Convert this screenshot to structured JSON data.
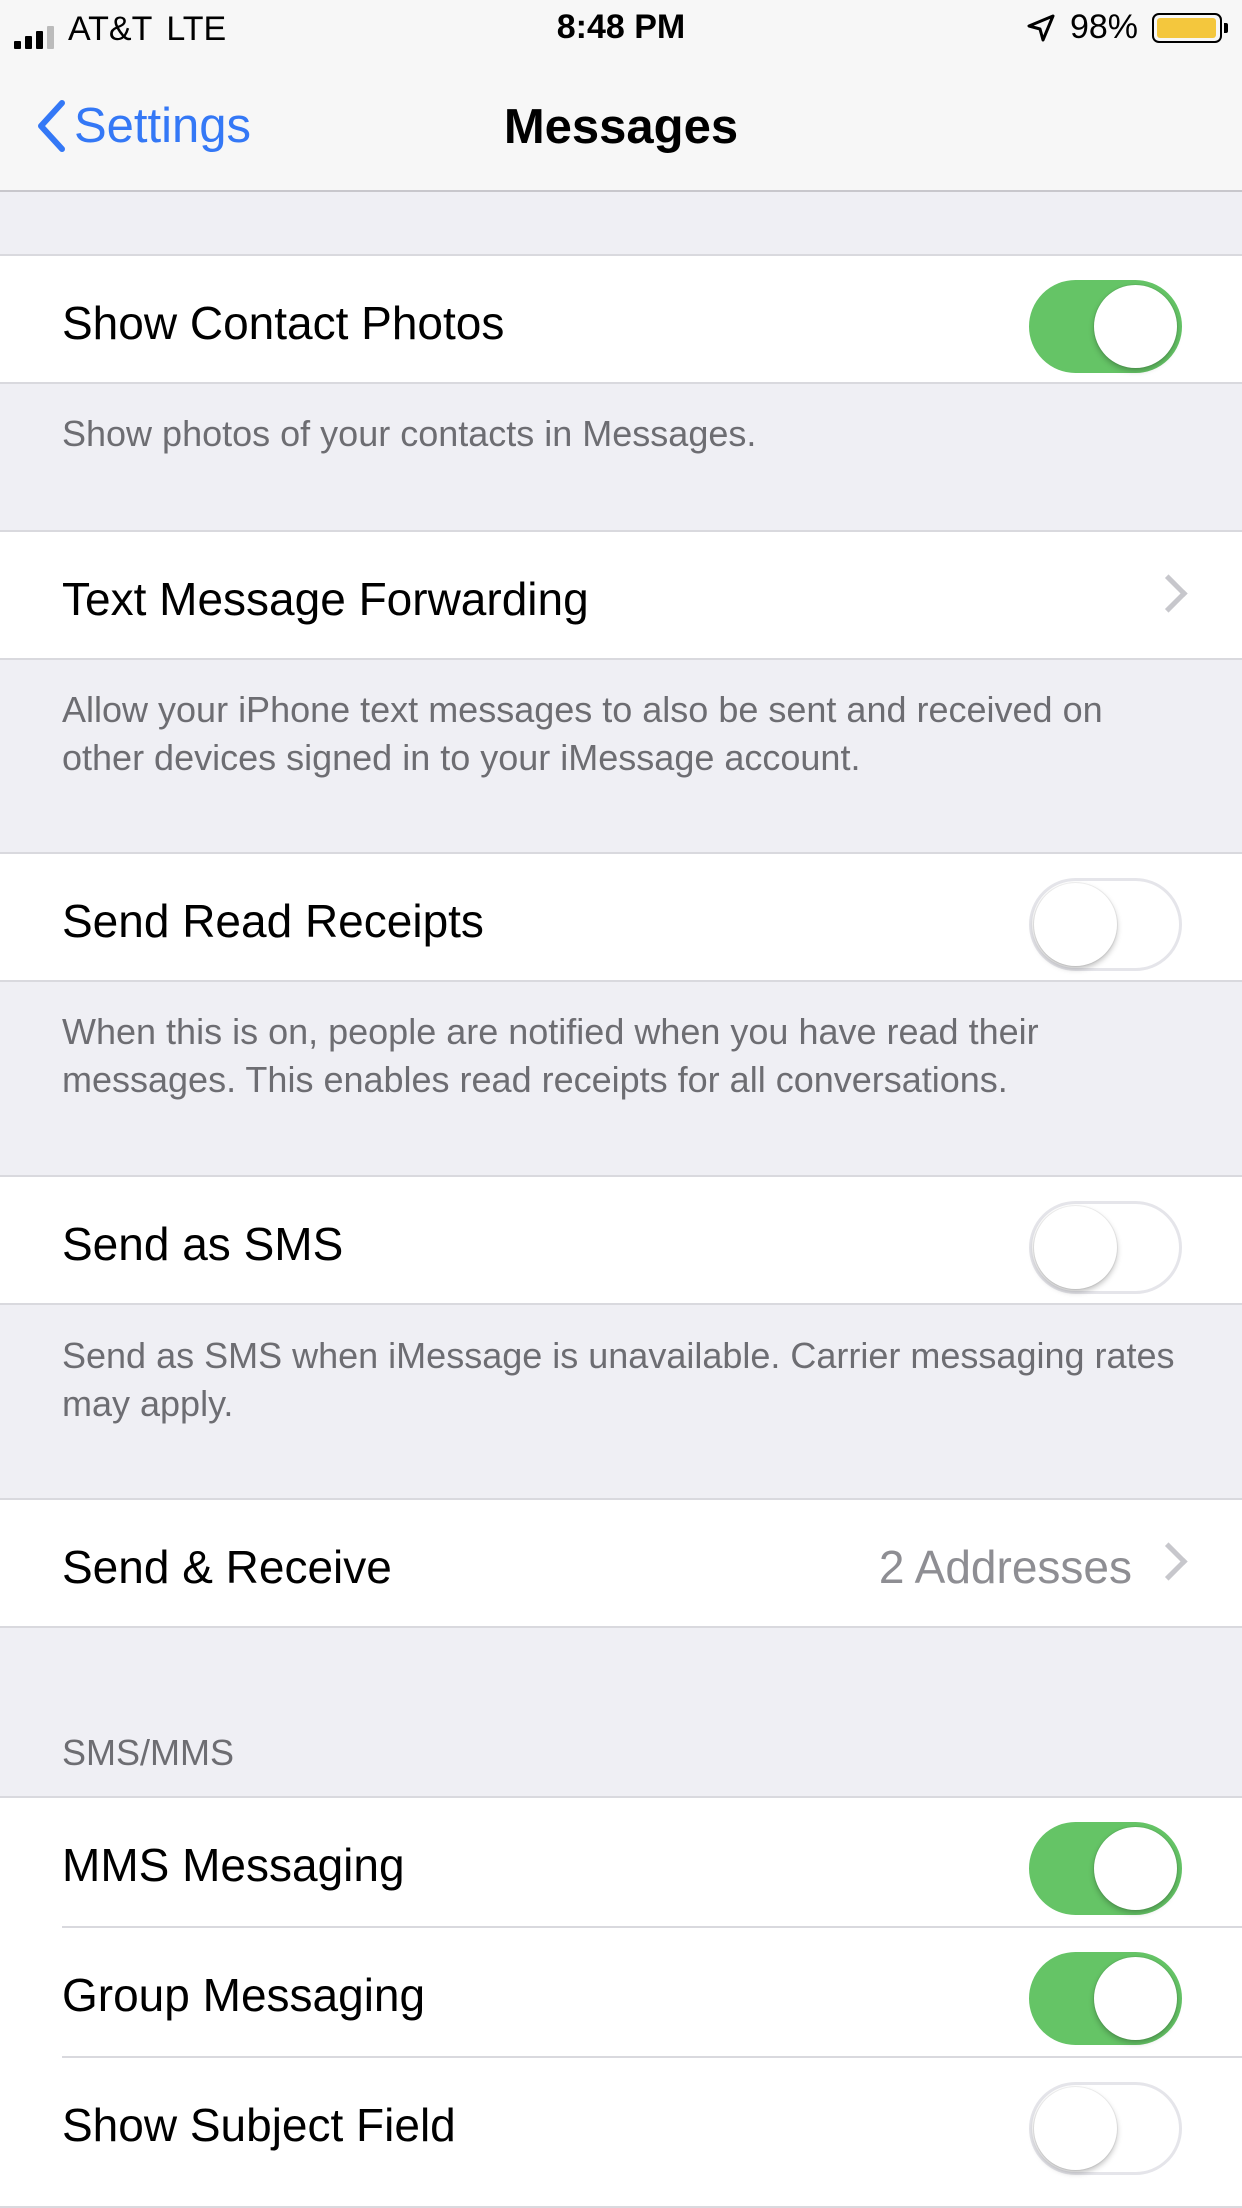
{
  "status_bar": {
    "carrier": "AT&T",
    "network": "LTE",
    "time": "8:48 PM",
    "battery_percent": "98%",
    "icons": [
      "signal-bars-icon",
      "location-arrow-icon",
      "battery-icon"
    ],
    "battery_level": 0.98,
    "battery_color": "#f4c73d"
  },
  "nav": {
    "back_label": "Settings",
    "title": "Messages",
    "accent_color": "#3478f6"
  },
  "rows": {
    "show_contact_photos": {
      "label": "Show Contact Photos",
      "switch_on": true
    },
    "show_contact_photos_footer": "Show photos of your contacts in Messages.",
    "text_forwarding": {
      "label": "Text Message Forwarding"
    },
    "text_forwarding_footer": "Allow your iPhone text messages to also be sent and received on other devices signed in to your iMessage account.",
    "read_receipts": {
      "label": "Send Read Receipts",
      "switch_on": false
    },
    "read_receipts_footer": "When this is on, people are notified when you have read their messages. This enables read receipts for all conversations.",
    "send_as_sms": {
      "label": "Send as SMS",
      "switch_on": false
    },
    "send_as_sms_footer": "Send as SMS when iMessage is unavailable. Carrier messaging rates may apply.",
    "send_receive": {
      "label": "Send & Receive",
      "detail": "2 Addresses"
    }
  },
  "sms_mms": {
    "header": "SMS/MMS",
    "mms_messaging": {
      "label": "MMS Messaging",
      "switch_on": true
    },
    "group_messaging": {
      "label": "Group Messaging",
      "switch_on": true
    },
    "show_subject_field": {
      "label": "Show Subject Field",
      "switch_on": false
    }
  },
  "colors": {
    "switch_on": "#65c466",
    "background": "#efeff4"
  }
}
